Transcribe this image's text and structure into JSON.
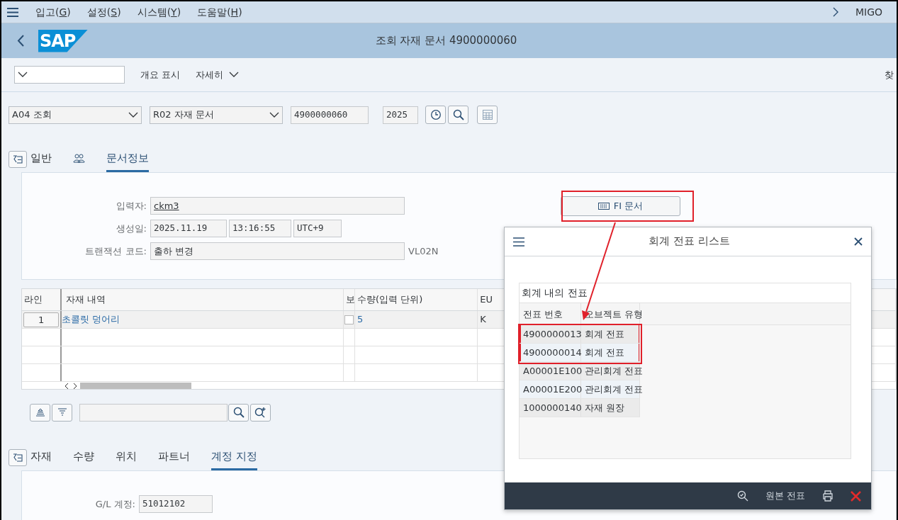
{
  "menu_bar": {
    "items": [
      {
        "before": "입고(",
        "key": "G",
        "after": ")"
      },
      {
        "before": "설정(",
        "key": "S",
        "after": ")"
      },
      {
        "before": "시스템(",
        "key": "Y",
        "after": ")"
      },
      {
        "before": "도움말(",
        "key": "H",
        "after": ")"
      }
    ],
    "transaction": "MIGO"
  },
  "title_bar": {
    "logo": "SAP",
    "title": "조회 자재 문서 4900000060"
  },
  "toolbar": {
    "buttons": [
      {
        "label": "개요 표시",
        "kind": "plain"
      },
      {
        "label": "자세히",
        "kind": "menu"
      }
    ],
    "cut_off": "찾"
  },
  "header": {
    "action": "A04 조회",
    "reference": "R02 자재 문서",
    "document_number": "4900000060",
    "year": "2025"
  },
  "header_tabs": [
    {
      "kind": "text",
      "label": "일반",
      "selected": false
    },
    {
      "kind": "icon",
      "selected": false
    },
    {
      "kind": "text",
      "label": "문서정보",
      "selected": true
    }
  ],
  "doc_info": {
    "fields": [
      {
        "label": "입력자:",
        "values": [
          "ckm3"
        ],
        "kind": "link"
      },
      {
        "label": "생성일:",
        "values": [
          "2025.11.19",
          "13:16:55",
          "UTC+9"
        ],
        "kind": "split"
      },
      {
        "label": "트랜잭션 코드:",
        "values": [
          "출하 변경"
        ],
        "kind": "plain",
        "suffix": "VL02N"
      }
    ],
    "fi_button": "FI 문서"
  },
  "items_table": {
    "columns": [
      "라인",
      "자재 내역",
      "보",
      "수량(입력 단위)",
      "EU"
    ],
    "rows": [
      {
        "line": "1",
        "material": "초콜릿 덩어리",
        "checked": false,
        "quantity": "5",
        "unit": "K"
      }
    ]
  },
  "detail_tabs": [
    {
      "label": "자재",
      "selected": false
    },
    {
      "label": "수량",
      "selected": false
    },
    {
      "label": "위치",
      "selected": false
    },
    {
      "label": "파트너",
      "selected": false
    },
    {
      "label": "계정 지정",
      "selected": true
    }
  ],
  "account": {
    "label": "G/L 계정:",
    "value": "51012102"
  },
  "dialog": {
    "title": "회계 전표 리스트",
    "caption": "회계 내의 전표",
    "columns": [
      "전표 번호",
      "오브젝트 유형"
    ],
    "rows": [
      {
        "number": "4900000013",
        "type": "회계 전표",
        "highlighted": true
      },
      {
        "number": "4900000014",
        "type": "회계 전표",
        "highlighted": true
      },
      {
        "number": "A00001E100",
        "type": "관리회계 전표",
        "highlighted": false
      },
      {
        "number": "A00001E200",
        "type": "관리회계 전표",
        "highlighted": false
      },
      {
        "number": "1000000140",
        "type": "자재 원장",
        "highlighted": false
      }
    ],
    "footer_button": "원본 전표"
  }
}
